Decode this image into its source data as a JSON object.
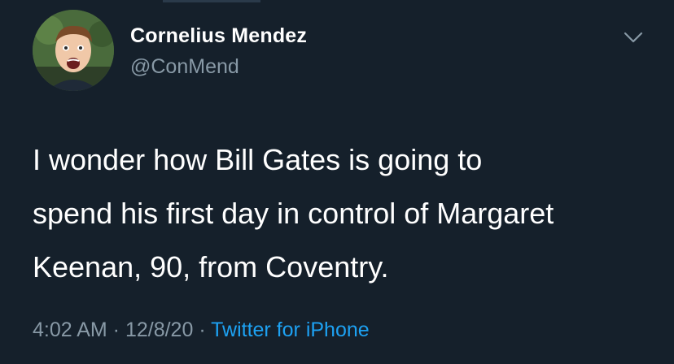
{
  "tweet": {
    "display_name": "Cornelius Mendez",
    "handle": "@ConMend",
    "text": "I wonder how Bill Gates is going to\nspend his first day in control of Margaret\nKeenan, 90, from Coventry.",
    "time": "4:02 AM",
    "separator": " · ",
    "date": "12/8/20",
    "source": "Twitter for iPhone"
  },
  "icons": {
    "menu": "chevron-down-icon",
    "avatar": "avatar"
  },
  "colors": {
    "background": "#15202b",
    "primary_text": "#ffffff",
    "secondary_text": "#8899a6",
    "accent": "#1da1f2"
  }
}
